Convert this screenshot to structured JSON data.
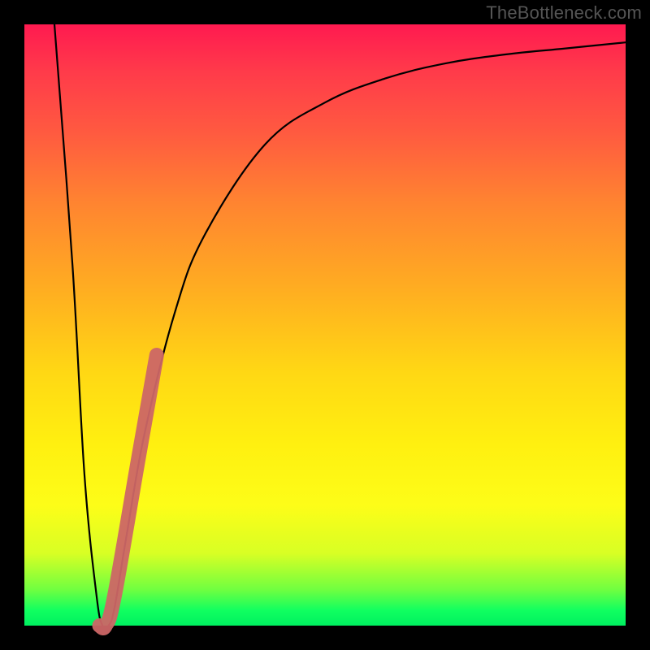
{
  "watermark": "TheBottleneck.com",
  "chart_data": {
    "type": "line",
    "title": "",
    "xlabel": "",
    "ylabel": "",
    "xlim": [
      0,
      100
    ],
    "ylim": [
      0,
      100
    ],
    "grid": false,
    "series": [
      {
        "name": "bottleneck-curve",
        "x": [
          5,
          8,
          10,
          12,
          13,
          14,
          15,
          17,
          20,
          25,
          30,
          40,
          50,
          60,
          70,
          80,
          90,
          100
        ],
        "y": [
          100,
          60,
          25,
          5,
          0,
          0,
          3,
          15,
          32,
          52,
          65,
          80,
          87,
          91,
          93.5,
          95,
          96,
          97
        ]
      }
    ],
    "highlight": {
      "name": "highlight-segment",
      "x": [
        12.5,
        13.5,
        15,
        19,
        22
      ],
      "y": [
        0,
        0,
        5,
        28,
        45
      ],
      "color": "#cc6666"
    }
  }
}
